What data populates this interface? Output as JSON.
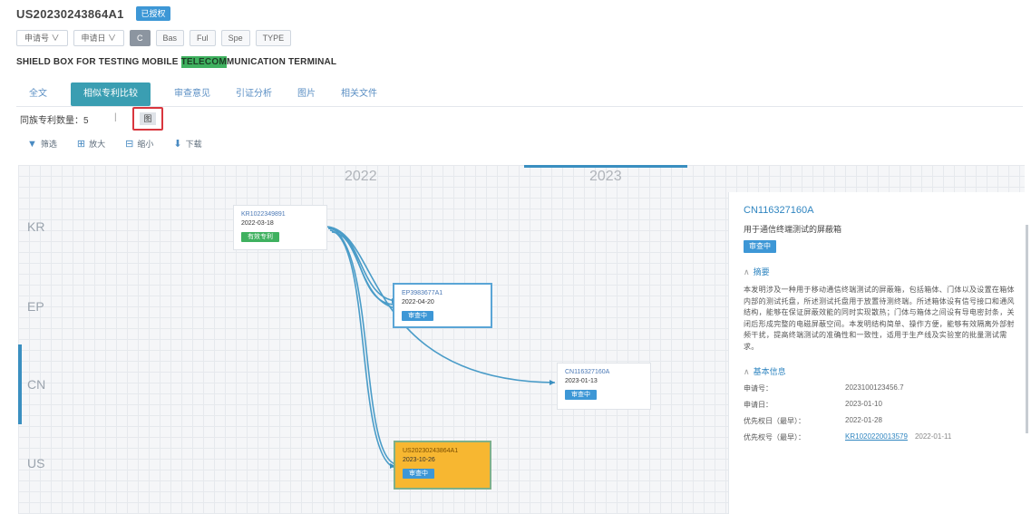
{
  "header": {
    "title": "US20230243864A1",
    "badge": "已授权"
  },
  "filters": {
    "selects": [
      "申请号 ∨",
      "申请日 ∨"
    ],
    "buttons": [
      "C",
      "Bas",
      "Ful",
      "Spe",
      "TYPE"
    ]
  },
  "subject": {
    "before": "SHIELD BOX FOR TESTING MOBILE ",
    "highlight": "TELECOM",
    "after": "MUNICATION TERMINAL"
  },
  "tabs": [
    "全文",
    "相似专利比较",
    "审查意见",
    "引证分析",
    "图片",
    "相关文件"
  ],
  "toolbar": {
    "count_label": "同族专利数量：5",
    "count_sep": "|",
    "view_button": "图",
    "tools": [
      "筛选",
      "放大",
      "缩小",
      "下载"
    ]
  },
  "timeline": {
    "years": [
      "2022",
      "2023"
    ],
    "rows": [
      "KR",
      "EP",
      "CN",
      "US"
    ]
  },
  "cards": [
    {
      "no": "KR1022349891",
      "date": "2022-03-18",
      "badge": "有效专利"
    },
    {
      "no": "EP3983677A1",
      "date": "2022-04-20",
      "badge": "审查中"
    },
    {
      "no": "CN116327160A",
      "date": "2023-01-13",
      "badge": "审查中"
    },
    {
      "no": "US20230243864A1",
      "date": "2023-10-26",
      "badge": "审查中"
    }
  ],
  "panel": {
    "number": "CN116327160A",
    "subtitle": "用于通信终端测试的屏蔽箱",
    "badge": "审查中",
    "abstract_title": "摘要",
    "abstract": "本发明涉及一种用于移动通信终端测试的屏蔽箱，包括箱体、门体以及设置在箱体内部的测试托盘，所述测试托盘用于放置待测终端。所述箱体设有信号接口和通风结构，能够在保证屏蔽效能的同时实现散热；门体与箱体之间设有导电密封条，关闭后形成完整的电磁屏蔽空间。本发明结构简单、操作方便，能够有效隔离外部射频干扰，提高终端测试的准确性和一致性，适用于生产线及实验室的批量测试需求。",
    "basic_title": "基本信息",
    "fields": [
      {
        "k": "申请号：",
        "v": "2023100123456.7"
      },
      {
        "k": "申请日：",
        "v": "2023-01-10"
      },
      {
        "k": "优先权日（最早）：",
        "v": "2022-01-28"
      },
      {
        "k": "优先权号（最早）：",
        "v": "KR1020220013579",
        "v2": "2022-01-11"
      }
    ]
  }
}
